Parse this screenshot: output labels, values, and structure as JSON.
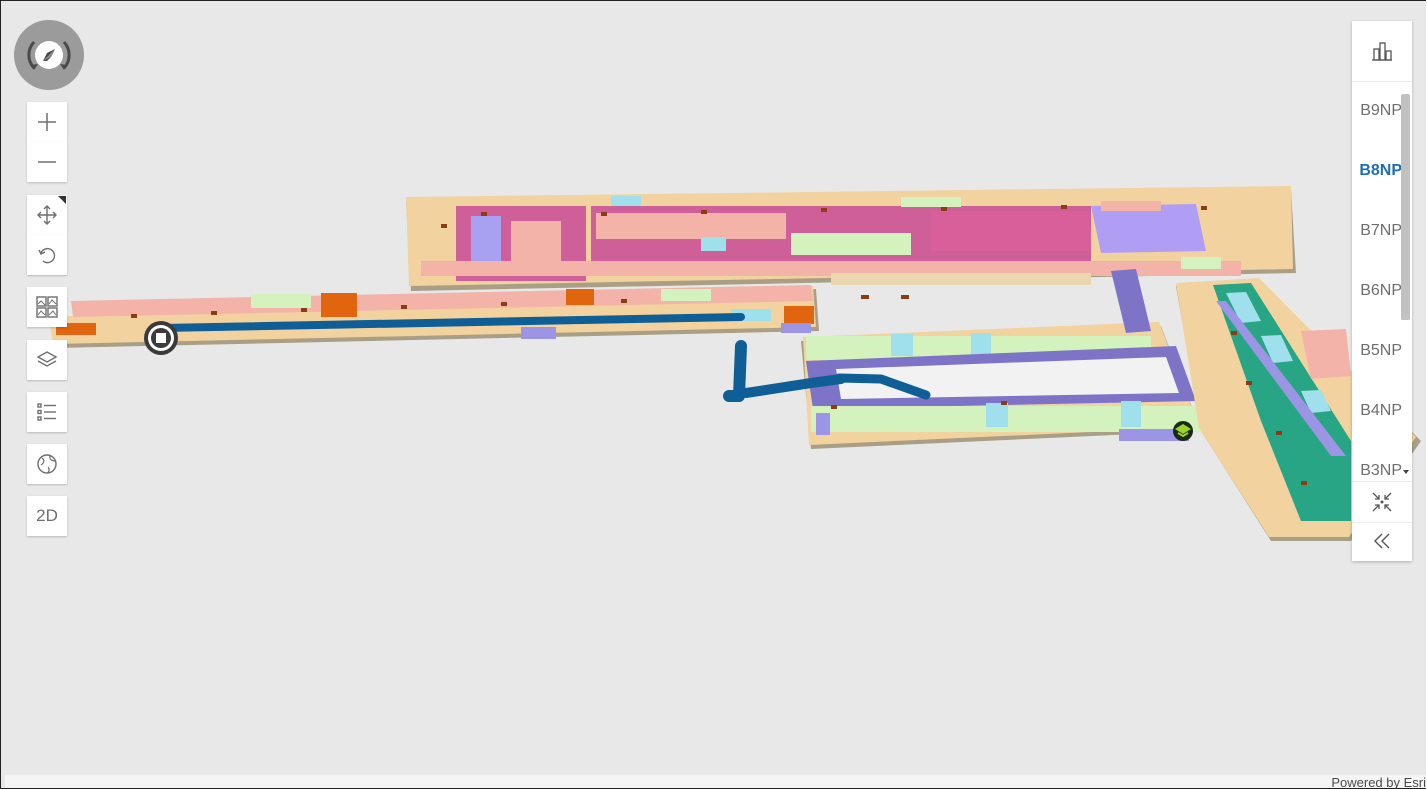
{
  "map": {
    "attribution": "Powered by Esri"
  },
  "toolbar": {
    "compass_icon": "compass-icon",
    "zoom_in_icon": "plus-icon",
    "zoom_out_icon": "minus-icon",
    "pan_icon": "move-icon",
    "rotate_icon": "rotate-icon",
    "basemap_icon": "basemap-gallery-icon",
    "layers_icon": "layers-icon",
    "legend_icon": "list-icon",
    "globe_icon": "globe-icon",
    "view_toggle_label": "2D"
  },
  "floor_filter": {
    "building_icon": "building-icon",
    "floors": [
      {
        "label": "B9NP",
        "active": false
      },
      {
        "label": "B8NP",
        "active": true
      },
      {
        "label": "B7NP",
        "active": false
      },
      {
        "label": "B6NP",
        "active": false
      },
      {
        "label": "B5NP",
        "active": false
      },
      {
        "label": "B4NP",
        "active": false
      },
      {
        "label": "B3NP",
        "active": false
      }
    ],
    "zoom_to_icon": "zoom-to-icon",
    "collapse_icon": "double-chevron-left-icon"
  },
  "colors": {
    "route": "#0f5e96",
    "active_floor": "#1f6fb0",
    "room_beige": "#f2d29e",
    "room_pink": "#f3b3a9",
    "room_magenta": "#cf5f98",
    "room_green": "#d3f2bd",
    "room_cyan": "#9fe0ec",
    "room_purple": "#8b7fd0",
    "room_orange": "#e0650e",
    "room_teal": "#28a584"
  }
}
